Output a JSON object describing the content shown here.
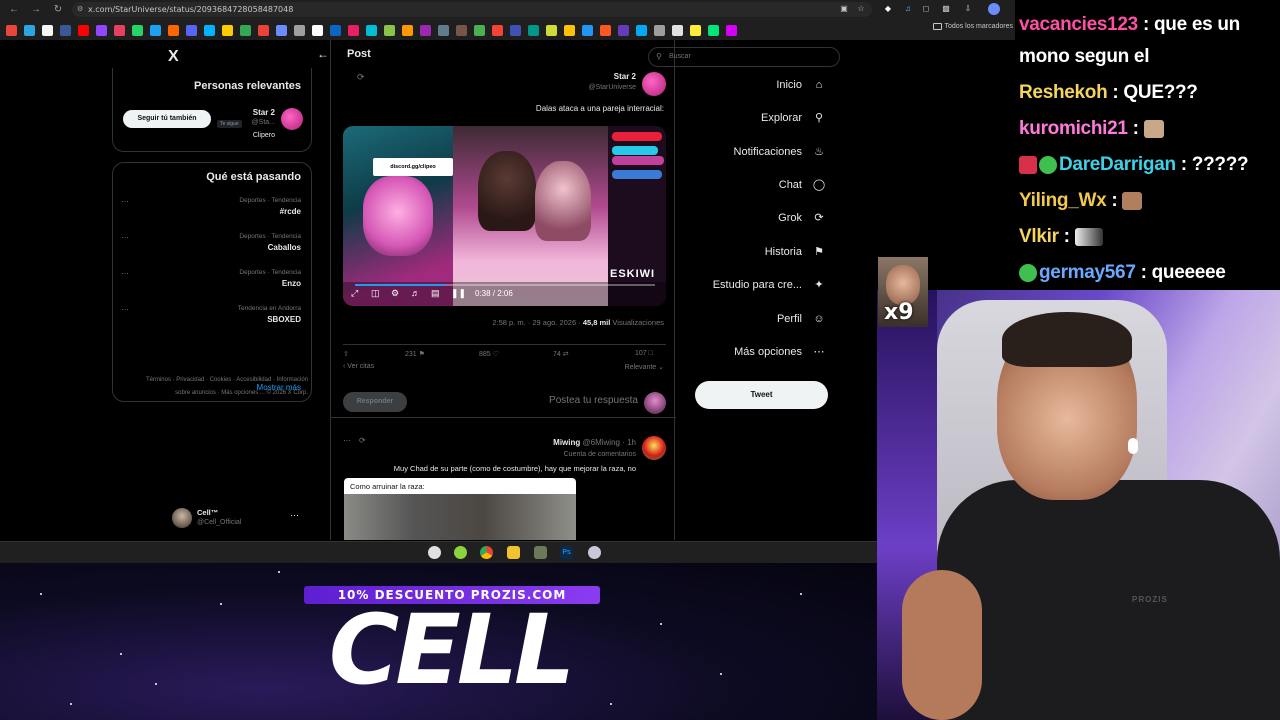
{
  "browser": {
    "url": "x.com/StarUniverse/status/2093684728058487048",
    "bookmarks_folder": "Todos los marcadores"
  },
  "x": {
    "header_title": "Post",
    "search_placeholder": "Buscar",
    "nav": [
      {
        "label": "Inicio",
        "icon": "home-icon"
      },
      {
        "label": "Explorar",
        "icon": "search-icon"
      },
      {
        "label": "Notificaciones",
        "icon": "bell-icon"
      },
      {
        "label": "Chat",
        "icon": "chat-icon"
      },
      {
        "label": "Grok",
        "icon": "grok-icon"
      },
      {
        "label": "Historia",
        "icon": "bookmark-icon"
      },
      {
        "label": "Estudio para cre...",
        "icon": "creator-studio-icon"
      },
      {
        "label": "Perfil",
        "icon": "profile-icon"
      },
      {
        "label": "Más opciones",
        "icon": "more-icon"
      }
    ],
    "tweet_button": "Tweet",
    "relevant": {
      "title": "Personas relevantes",
      "name": "Star 2",
      "handle": "@Sta...",
      "badge": "Te sigue",
      "bio": "Clipero",
      "follow_label": "Seguir tú también"
    },
    "trending": {
      "title": "Qué está pasando",
      "items": [
        {
          "context": "Deportes · Tendencia",
          "name": "#rcde"
        },
        {
          "context": "Deportes · Tendencia",
          "name": "Caballos"
        },
        {
          "context": "Deportes · Tendencia",
          "name": "Enzo"
        },
        {
          "context": "Tendencia en Andorra",
          "name": "SBOXED"
        }
      ],
      "show_more": "Mostrar más"
    },
    "footer_links": "Términos · Privacidad · Cookies · Accesibilidad · Información sobre anuncios · Más opciones ... © 2026 X Corp.",
    "account": {
      "name": "Cell™",
      "handle": "@Cell_Official"
    },
    "post": {
      "author": "Star 2",
      "handle": "@StarUniverse",
      "text": "Dalas ataca a una pareja interracial:",
      "video_caption": "discord.gg/clipeo",
      "video_watermark": "ESKIWI",
      "video_time": "0:38 / 2:06",
      "video_progress": 0.3,
      "meta": "2:58 p. m. · 29 ago. 2026 · ",
      "views": "45,8 mil",
      "views_label": " Visualizaciones",
      "stats": {
        "replies": "107",
        "reposts": "74",
        "likes": "885",
        "bookmarks": "231"
      },
      "relevance": "Relevante",
      "see_quotes": "Ver citas"
    },
    "reply_box": {
      "placeholder": "Postea tu respuesta",
      "button": "Responder"
    },
    "reply": {
      "name": "Miwing",
      "handle": "@6Miwing · 1h",
      "sub": "Cuenta de comentarios",
      "text": "Muy Chad de su parte (como de costumbre), hay que mejorar la raza, no",
      "image_caption": "Como arruinar la raza:"
    }
  },
  "stream": {
    "promo": "10% DESCUENTO PROZIS.COM",
    "logo": "CELL",
    "multiplier": "x9",
    "shirt_logo": "PROZIS",
    "chat": [
      {
        "user": "vacancies123",
        "color": "#ff4fa3",
        "message": "que es un"
      },
      {
        "user": "",
        "color": "#ffffff",
        "message": "mono segun el"
      },
      {
        "user": "Reshekoh",
        "color": "#f4d35e",
        "message": "QUE???"
      },
      {
        "user": "kuromichi21",
        "color": "#ff7ad9",
        "message": ""
      },
      {
        "user": "DareDarrigan",
        "color": "#3fd0e8",
        "message": "?????"
      },
      {
        "user": "Yiling_Wx",
        "color": "#f2c94c",
        "message": ""
      },
      {
        "user": "Vlkir",
        "color": "#f4d35e",
        "message": ""
      },
      {
        "user": "germay567",
        "color": "#6aa9ff",
        "message": "queeeee"
      }
    ]
  }
}
